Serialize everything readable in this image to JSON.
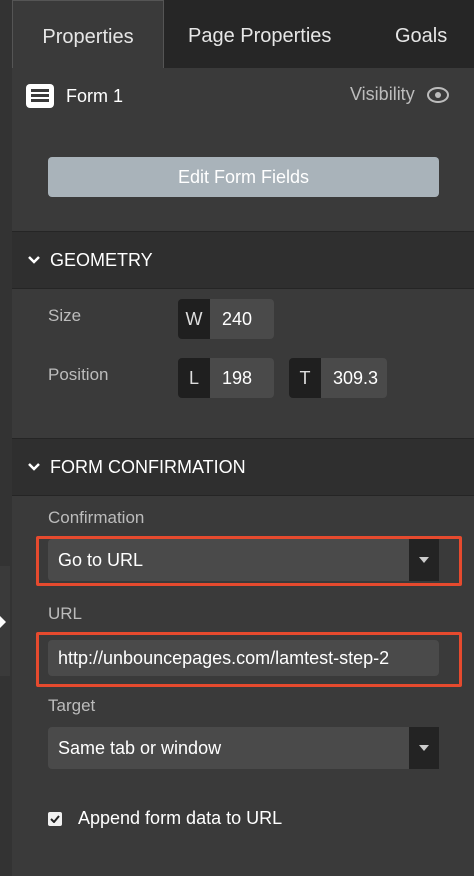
{
  "tabs": [
    {
      "label": "Properties",
      "active": true
    },
    {
      "label": "Page Properties",
      "active": false
    },
    {
      "label": "Goals",
      "active": false
    }
  ],
  "element": {
    "name": "Form 1",
    "icon": "form-icon"
  },
  "visibility": {
    "label": "Visibility",
    "icon": "eye-icon"
  },
  "edit_button": {
    "label": "Edit Form Fields"
  },
  "geometry": {
    "title": "GEOMETRY",
    "size_label": "Size",
    "position_label": "Position",
    "width": {
      "key": "W",
      "value": "240"
    },
    "left": {
      "key": "L",
      "value": "198"
    },
    "top": {
      "key": "T",
      "value": "309.3"
    }
  },
  "form_confirmation": {
    "title": "FORM CONFIRMATION",
    "confirmation_label": "Confirmation",
    "confirmation_value": "Go to URL",
    "url_label": "URL",
    "url_value": "http://unbouncepages.com/lamtest-step-2",
    "target_label": "Target",
    "target_value": "Same tab or window",
    "append_label": "Append form data to URL",
    "append_checked": true
  },
  "colors": {
    "highlight": "#e64a2e",
    "button": "#a9b3ba"
  }
}
